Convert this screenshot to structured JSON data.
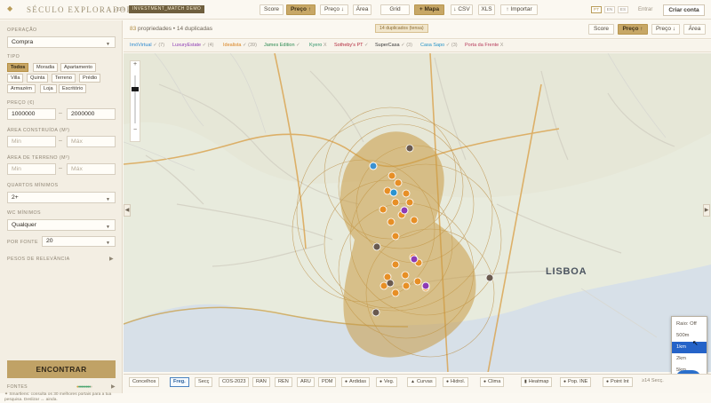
{
  "app": {
    "title": "SÉCULO EXPLORADOR",
    "version": "v239",
    "badge": "INVESTMENT_MATCH DEMO",
    "header_buttons": [
      "Score",
      "Preço ↑",
      "Preço ↓",
      "Área",
      "Grid",
      "+ Mapa",
      "↓ CSV",
      "XLS",
      "↑ Importar"
    ],
    "languages": [
      "PT",
      "EN",
      "ES"
    ],
    "login": "Entrar",
    "create_account": "Criar conta"
  },
  "sidebar": {
    "operation_label": "OPERAÇÃO",
    "operation_value": "Compra",
    "type_label": "TIPO",
    "types": [
      "Todos",
      "Moradia",
      "Apartamento",
      "Villa",
      "Quinta",
      "Terreno",
      "Prédio",
      "Armazém",
      "Loja",
      "Escritório"
    ],
    "price_label": "PREÇO (€)",
    "price_min": "1000000",
    "price_max": "2000000",
    "built_area_label": "ÁREA CONSTRUÍDA (M²)",
    "land_area_label": "ÁREA DE TERRENO (M²)",
    "min_placeholder": "Min",
    "max_placeholder": "Máx",
    "bedrooms_label": "QUARTOS MÍNIMOS",
    "bedrooms_value": "2+",
    "wc_label": "WC MÍNIMOS",
    "wc_value": "Qualquer",
    "per_source_label": "POR FONTE",
    "per_source_value": "20",
    "relevance_label": "PESOS DE RELEVÂNCIA",
    "search_button": "ENCONTRAR",
    "sources_label": "FONTES",
    "footer_text": "✦ Smartlens: consulta os 30 melhores portais para a tua pesquisa. Deslizar ↔ ainda."
  },
  "results": {
    "count": "83",
    "summary": "propriedades • 14 duplicadas",
    "duplicates_badge": "14 duplicados (tensa)",
    "sort_buttons": [
      "Score",
      "Preço ↑",
      "Preço ↓",
      "Área"
    ]
  },
  "sources": [
    {
      "name": "ImóVirtual",
      "mark": "✓",
      "count": "(7)",
      "color": "#2f8bd0"
    },
    {
      "name": "LuxuryEstate",
      "mark": "✓",
      "count": "(4)",
      "color": "#8d3bb4"
    },
    {
      "name": "Idealista",
      "mark": "✓",
      "count": "(39)",
      "color": "#d9821e"
    },
    {
      "name": "James Edition",
      "mark": "✓",
      "count": "",
      "color": "#2c8a52"
    },
    {
      "name": "Kyero",
      "mark": "X",
      "count": "",
      "color": "#2e9368"
    },
    {
      "name": "Sotheby's PT",
      "mark": "✓",
      "count": "",
      "color": "#b2273b"
    },
    {
      "name": "SuperCasa",
      "mark": "✓",
      "count": "(3)",
      "color": "#363636"
    },
    {
      "name": "Casa Sapo",
      "mark": "✓",
      "count": "(3)",
      "color": "#2493c7"
    },
    {
      "name": "Porta da Frente",
      "mark": "X",
      "count": "",
      "color": "#b6395a"
    }
  ],
  "map": {
    "city_label": "LISBOA",
    "radius_options": [
      "Raio: Off",
      "500m",
      "1km",
      "2km",
      "5km"
    ],
    "radius_selected": "1km",
    "zoom_in": "+",
    "zoom_out": "−",
    "colors": {
      "accent": "#c7a766",
      "radius_fill": "#c99a43",
      "selected": "#2563c8",
      "map_bg": "#e9ecde"
    }
  },
  "bottom_bar": [
    "Concelhos",
    "Freg.",
    "Secç",
    "COS-2023",
    "RAN",
    "REN",
    "ARU",
    "PDM",
    "Ardidas",
    "Veg.",
    "Curvas",
    "Hidrol.",
    "Clima",
    "Heatmap",
    "Pop. INE",
    "Point Int",
    "≥14 Secç."
  ],
  "bottom_bar_active": "Freg."
}
